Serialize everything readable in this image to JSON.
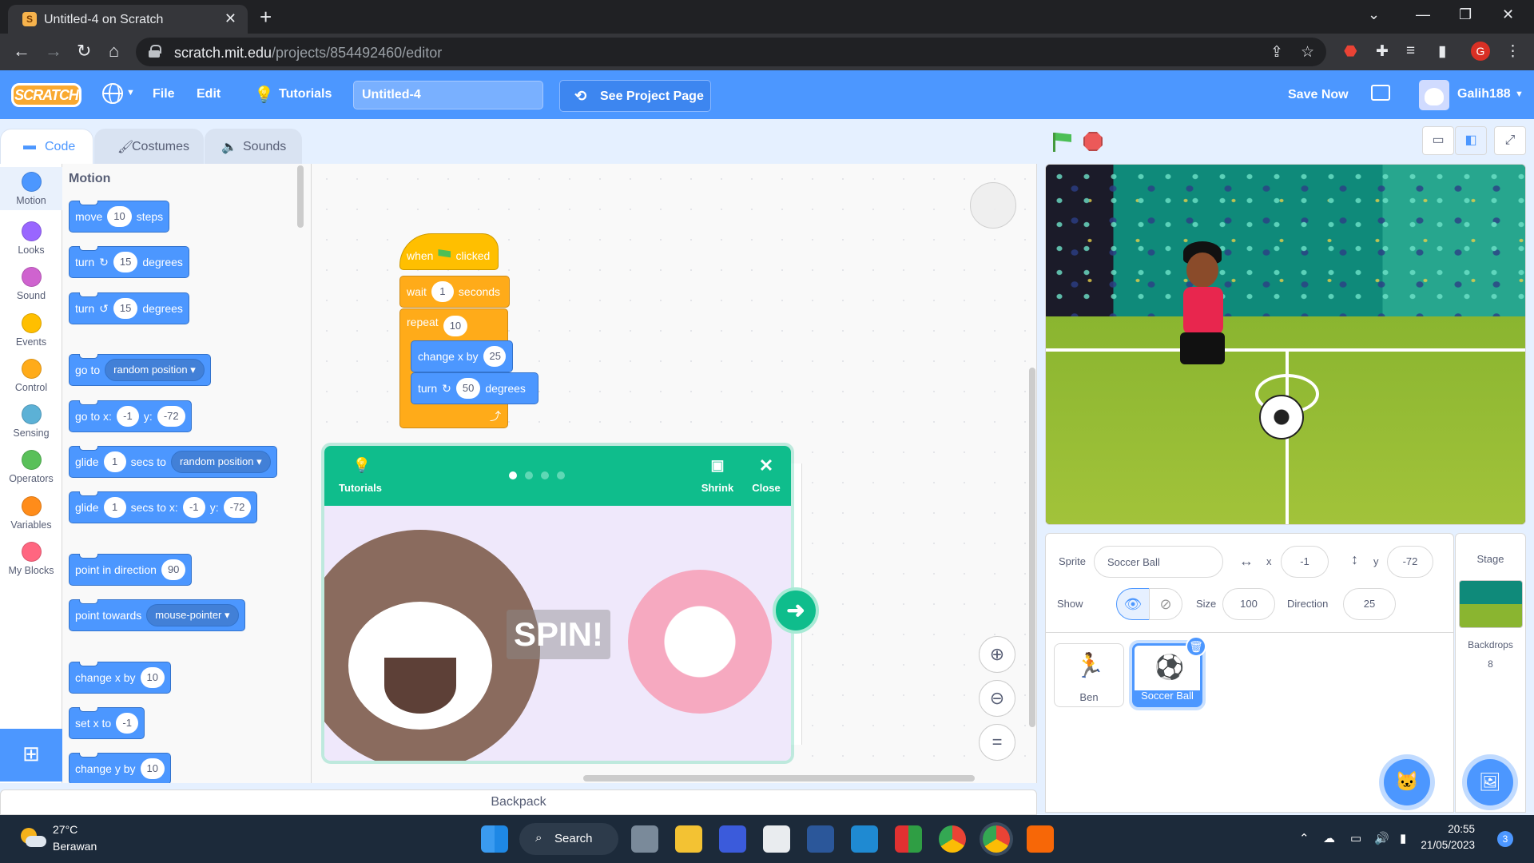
{
  "browser": {
    "tab_title": "Untitled-4 on Scratch",
    "url_host": "scratch.mit.edu",
    "url_path": "/projects/854492460/editor",
    "profile_initial": "G"
  },
  "menu": {
    "logo": "SCRATCH",
    "file": "File",
    "edit": "Edit",
    "tutorials": "Tutorials",
    "project_title": "Untitled-4",
    "see_project_page": "See Project Page",
    "save_now": "Save Now",
    "username": "Galih188"
  },
  "editor_tabs": [
    "Code",
    "Costumes",
    "Sounds"
  ],
  "categories": [
    {
      "label": "Motion",
      "color": "#4c97ff"
    },
    {
      "label": "Looks",
      "color": "#9966ff"
    },
    {
      "label": "Sound",
      "color": "#cf63cf"
    },
    {
      "label": "Events",
      "color": "#ffbf00"
    },
    {
      "label": "Control",
      "color": "#ffab19"
    },
    {
      "label": "Sensing",
      "color": "#5cb1d6"
    },
    {
      "label": "Operators",
      "color": "#59c059"
    },
    {
      "label": "Variables",
      "color": "#ff8c1a"
    },
    {
      "label": "My Blocks",
      "color": "#ff6680"
    }
  ],
  "palette": {
    "header": "Motion",
    "move": {
      "a": "move",
      "v": "10",
      "b": "steps"
    },
    "turn_cw": {
      "a": "turn",
      "v": "15",
      "b": "degrees"
    },
    "turn_ccw": {
      "a": "turn",
      "v": "15",
      "b": "degrees"
    },
    "goto": {
      "a": "go to",
      "dd": "random position"
    },
    "goto_xy": {
      "a": "go to x:",
      "x": "-1",
      "b": "y:",
      "y": "-72"
    },
    "glide_to": {
      "a": "glide",
      "v": "1",
      "b": "secs to",
      "dd": "random position"
    },
    "glide_xy": {
      "a": "glide",
      "v": "1",
      "b": "secs to x:",
      "x": "-1",
      "c": "y:",
      "y": "-72"
    },
    "point_dir": {
      "a": "point in direction",
      "v": "90"
    },
    "point_towards": {
      "a": "point towards",
      "dd": "mouse-pointer"
    },
    "change_x": {
      "a": "change x by",
      "v": "10"
    },
    "set_x": {
      "a": "set x to",
      "v": "-1"
    },
    "change_y": {
      "a": "change y by",
      "v": "10"
    }
  },
  "script": {
    "hat_when": "when",
    "hat_clicked": "clicked",
    "wait": {
      "a": "wait",
      "v": "1",
      "b": "seconds"
    },
    "repeat": {
      "a": "repeat",
      "v": "10"
    },
    "change_x": {
      "a": "change x by",
      "v": "25"
    },
    "turn": {
      "a": "turn",
      "v": "50",
      "b": "degrees"
    }
  },
  "tutorial": {
    "tutorials_label": "Tutorials",
    "shrink_label": "Shrink",
    "close_label": "Close",
    "caption": "SPIN!",
    "steps": 4,
    "current_step": 1
  },
  "sprite_info": {
    "sprite_label": "Sprite",
    "sprite_name": "Soccer Ball",
    "x_label": "x",
    "x_value": "-1",
    "y_label": "y",
    "y_value": "-72",
    "show_label": "Show",
    "size_label": "Size",
    "size_value": "100",
    "direction_label": "Direction",
    "direction_value": "25"
  },
  "sprites": [
    {
      "name": "Ben",
      "selected": false
    },
    {
      "name": "Soccer Ball",
      "selected": true
    }
  ],
  "stage_panel": {
    "title": "Stage",
    "backdrops_label": "Backdrops",
    "backdrops_count": "8"
  },
  "backpack_label": "Backpack",
  "taskbar": {
    "temperature": "27°C",
    "weather": "Berawan",
    "search": "Search",
    "time": "20:55",
    "date": "21/05/2023",
    "notifications": "3"
  }
}
